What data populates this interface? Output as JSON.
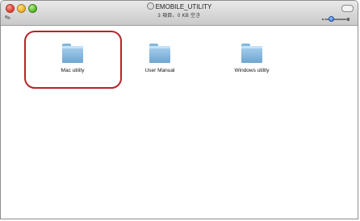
{
  "window": {
    "title": "EMOBILE_UTILITY",
    "status": "3 項目、0 KB 空き"
  },
  "items": [
    {
      "label": "Mac utility",
      "icon": "folder-icon",
      "highlighted": true
    },
    {
      "label": "User Manual",
      "icon": "folder-icon",
      "highlighted": false
    },
    {
      "label": "Windows utility",
      "icon": "folder-icon",
      "highlighted": false
    }
  ],
  "colors": {
    "folder": "#8fc0e4",
    "highlight": "#b7242b"
  }
}
